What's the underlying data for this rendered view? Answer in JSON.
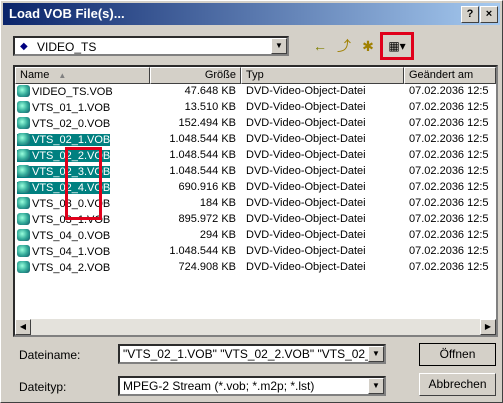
{
  "window": {
    "title": "Load VOB File(s)...",
    "help": "?",
    "close": "×"
  },
  "location": {
    "value": "VIDEO_TS"
  },
  "toolbar": {
    "back": "←",
    "up": "⤴",
    "newfolder": "✱",
    "view": "▦▾"
  },
  "columns": {
    "name": "Name",
    "size": "Größe",
    "type": "Typ",
    "modified": "Geändert am"
  },
  "files": [
    {
      "name": "VIDEO_TS.VOB",
      "size": "47.648 KB",
      "type": "DVD-Video-Object-Datei",
      "modified": "07.02.2036 12:5",
      "selected": false
    },
    {
      "name": "VTS_01_1.VOB",
      "size": "13.510 KB",
      "type": "DVD-Video-Object-Datei",
      "modified": "07.02.2036 12:5",
      "selected": false
    },
    {
      "name": "VTS_02_0.VOB",
      "size": "152.494 KB",
      "type": "DVD-Video-Object-Datei",
      "modified": "07.02.2036 12:5",
      "selected": false
    },
    {
      "name": "VTS_02_1.VOB",
      "size": "1.048.544 KB",
      "type": "DVD-Video-Object-Datei",
      "modified": "07.02.2036 12:5",
      "selected": true
    },
    {
      "name": "VTS_02_2.VOB",
      "size": "1.048.544 KB",
      "type": "DVD-Video-Object-Datei",
      "modified": "07.02.2036 12:5",
      "selected": true
    },
    {
      "name": "VTS_02_3.VOB",
      "size": "1.048.544 KB",
      "type": "DVD-Video-Object-Datei",
      "modified": "07.02.2036 12:5",
      "selected": true
    },
    {
      "name": "VTS_02_4.VOB",
      "size": "690.916 KB",
      "type": "DVD-Video-Object-Datei",
      "modified": "07.02.2036 12:5",
      "selected": true
    },
    {
      "name": "VTS_03_0.VOB",
      "size": "184 KB",
      "type": "DVD-Video-Object-Datei",
      "modified": "07.02.2036 12:5",
      "selected": false
    },
    {
      "name": "VTS_03_1.VOB",
      "size": "895.972 KB",
      "type": "DVD-Video-Object-Datei",
      "modified": "07.02.2036 12:5",
      "selected": false
    },
    {
      "name": "VTS_04_0.VOB",
      "size": "294 KB",
      "type": "DVD-Video-Object-Datei",
      "modified": "07.02.2036 12:5",
      "selected": false
    },
    {
      "name": "VTS_04_1.VOB",
      "size": "1.048.544 KB",
      "type": "DVD-Video-Object-Datei",
      "modified": "07.02.2036 12:5",
      "selected": false
    },
    {
      "name": "VTS_04_2.VOB",
      "size": "724.908 KB",
      "type": "DVD-Video-Object-Datei",
      "modified": "07.02.2036 12:5",
      "selected": false
    }
  ],
  "filename": {
    "label": "Dateiname:",
    "value": "\"VTS_02_1.VOB\" \"VTS_02_2.VOB\" \"VTS_02_"
  },
  "filetype": {
    "label": "Dateityp:",
    "value": "MPEG-2 Stream (*.vob; *.m2p; *.lst)"
  },
  "buttons": {
    "open": "Öffnen",
    "cancel": "Abbrechen"
  },
  "colors": {
    "title_start": "#0a246a",
    "selection": "#008080",
    "highlight_box": "#e0001b"
  }
}
